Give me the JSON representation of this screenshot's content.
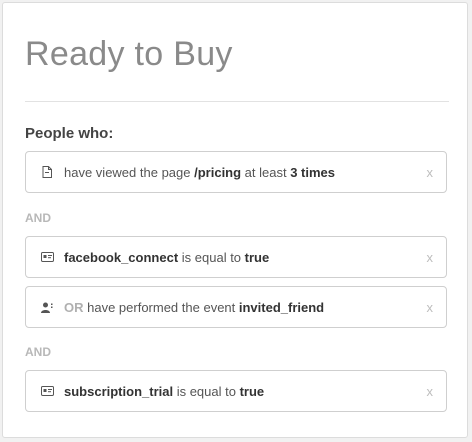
{
  "title": "Ready to Buy",
  "people_label": "People who:",
  "conjunction": "AND",
  "rules": [
    {
      "icon": "page-icon",
      "parts": [
        "have viewed the page ",
        "/pricing",
        " at least ",
        "3 times"
      ],
      "close": "x"
    },
    {
      "icon": "property-card-icon",
      "parts": [
        "facebook_connect",
        " is equal to ",
        "true"
      ],
      "close": "x"
    },
    {
      "icon": "user-event-icon",
      "or_label": "OR",
      "parts": [
        " have performed the event ",
        "invited_friend"
      ],
      "close": "x"
    },
    {
      "icon": "property-card-icon",
      "parts": [
        "subscription_trial",
        " is equal to ",
        "true"
      ],
      "close": "x"
    }
  ]
}
